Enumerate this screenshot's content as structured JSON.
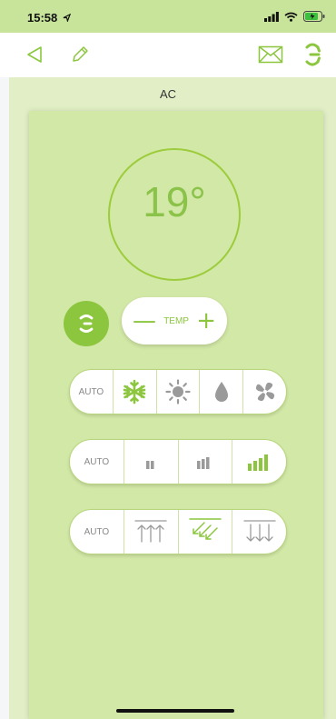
{
  "status": {
    "time": "15:58"
  },
  "title": "AC",
  "temperature": "19°",
  "temp_control": {
    "minus": "—",
    "label": "TEMP",
    "plus": "+"
  },
  "mode_row": {
    "auto": "AUTO",
    "icons": [
      "snowflake-icon",
      "sun-icon",
      "droplet-icon",
      "fan-icon"
    ],
    "selected": "snowflake"
  },
  "fan_row": {
    "auto": "AUTO",
    "levels": [
      "low",
      "medium",
      "high"
    ],
    "selected": "high"
  },
  "swing_row": {
    "auto": "AUTO",
    "icons": [
      "swing-up-icon",
      "swing-diagonal-icon",
      "swing-down-icon"
    ],
    "selected": "diagonal"
  },
  "colors": {
    "accent": "#8cc63f",
    "panel": "#d2e8a6",
    "background": "#e2efc6",
    "status_bar": "#c7e49a"
  }
}
